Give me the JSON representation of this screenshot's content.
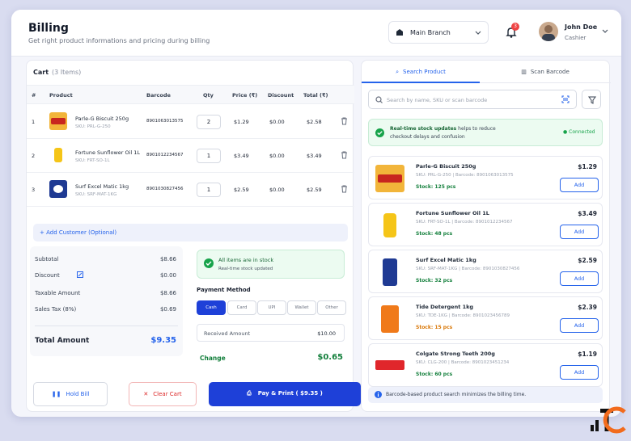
{
  "header": {
    "title": "Billing",
    "subtitle": "Get right product informations and pricing during billing",
    "branch": "Main Branch",
    "notifications": "3",
    "user_name": "John Doe",
    "user_role": "Cashier"
  },
  "cart": {
    "title": "Cart",
    "count": "(3 Items)",
    "columns": [
      "#",
      "Product",
      "Barcode",
      "Qty",
      "Price (₹)",
      "Discount",
      "Total (₹)"
    ],
    "rows": [
      {
        "num": "1",
        "name": "Parle-G Biscuit 250g",
        "sku": "SKU: PRL-G-250",
        "barcode": "8901063013575",
        "qty": "2",
        "price": "$1.29",
        "discount": "$0.00",
        "total": "$2.58"
      },
      {
        "num": "2",
        "name": "Fortune Sunflower Oil 1L",
        "sku": "SKU: FRT-SO-1L",
        "barcode": "8901012234567",
        "qty": "1",
        "price": "$3.49",
        "discount": "$0.00",
        "total": "$3.49"
      },
      {
        "num": "3",
        "name": "Surf Excel Matic 1kg",
        "sku": "SKU: SRF-MAT-1KG",
        "barcode": "8901030827456",
        "qty": "1",
        "price": "$2.59",
        "discount": "$0.00",
        "total": "$2.59"
      }
    ],
    "add_customer": "+  Add Customer (Optional)"
  },
  "summary": {
    "subtotal_label": "Subtotal",
    "subtotal": "$8.66",
    "discount_label": "Discount",
    "discount": "$0.00",
    "taxable_label": "Taxable Amount",
    "taxable": "$8.66",
    "tax_label": "Sales Tax (8%)",
    "tax": "$0.69",
    "total_label": "Total Amount",
    "total": "$9.35"
  },
  "stock_status": {
    "title": "All items are in stock",
    "sub": "Real-time stock updated"
  },
  "payment": {
    "title": "Payment Method",
    "methods": [
      "Cash",
      "Card",
      "UPI",
      "Wallet",
      "Other"
    ],
    "received_label": "Received Amount",
    "received": "$10.00",
    "change_label": "Change",
    "change": "$0.65"
  },
  "actions": {
    "hold": "Hold Bill",
    "clear": "Clear Cart",
    "pay": "Pay & Print ( $9.35 )"
  },
  "right": {
    "tab_search": "Search Product",
    "tab_scan": "Scan Barcode",
    "search_placeholder": "Search by name, SKU or scan barcode",
    "sync_bold": "Real-time stock updates",
    "sync_text": " helps to reduce checkout delays and confusion",
    "sync_status": "Connected",
    "products": [
      {
        "name": "Parle-G Biscuit 250g",
        "sku": "SKU: PRL-G-250  |  Barcode: 8901063013575",
        "stock": "Stock: 125 pcs",
        "price": "$1.29",
        "add": "Add"
      },
      {
        "name": "Fortune Sunflower Oil 1L",
        "sku": "SKU: FRT-SO-1L  |  Barcode: 8901012234567",
        "stock": "Stock: 48 pcs",
        "price": "$3.49",
        "add": "Add"
      },
      {
        "name": "Surf Excel Matic 1kg",
        "sku": "SKU: SRF-MAT-1KG  |  Barcode: 8901030827456",
        "stock": "Stock: 32 pcs",
        "price": "$2.59",
        "add": "Add"
      },
      {
        "name": "Tide Detergent 1kg",
        "sku": "SKU: TDE-1KG  |  Barcode: 8901023456789",
        "stock": "Stock: 15 pcs",
        "price": "$2.39",
        "add": "Add"
      },
      {
        "name": "Colgate Strong Teeth 200g",
        "sku": "SKU: CLG-200  |  Barcode: 8901023451234",
        "stock": "Stock: 60 pcs",
        "price": "$1.19",
        "add": "Add"
      }
    ],
    "note": "Barcode-based product search minimizes the billing time."
  },
  "colors": {
    "primary": "#1e40d8",
    "success": "#15803d",
    "danger": "#dc2626",
    "warning": "#d97706"
  }
}
